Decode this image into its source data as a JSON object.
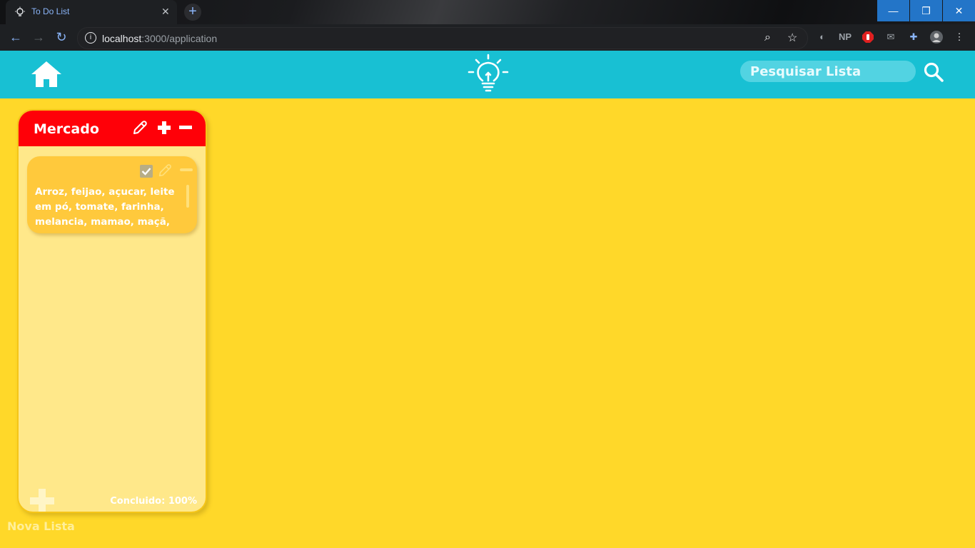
{
  "browser": {
    "tab_title": "To Do List",
    "tab_close": "✕",
    "new_tab": "+",
    "url_host": "localhost",
    "url_path": ":3000/application",
    "window_controls": [
      "—",
      "❐",
      "✕"
    ],
    "extensions": [
      "NP"
    ]
  },
  "app": {
    "search_placeholder": "Pesquisar Lista",
    "lists": [
      {
        "title": "Mercado",
        "header_color": "#ff0008",
        "items": [
          {
            "text": "Arroz, feijao, açucar, leite em pó, tomate, farinha, melancia, mamao, maçã,",
            "checked": true
          }
        ],
        "status": "Concluido: 100%",
        "progress": 1.0
      }
    ],
    "new_list_label": "Nova Lista"
  },
  "colors": {
    "background": "#ffd829",
    "header": "#18c0d3",
    "card": "#ffe88a",
    "item": "#ffc93c"
  },
  "icons": {
    "home": "home-icon",
    "bulb": "lightbulb-icon",
    "search": "search-icon",
    "edit": "pencil-icon",
    "add": "plus-icon",
    "remove": "minus-icon"
  }
}
